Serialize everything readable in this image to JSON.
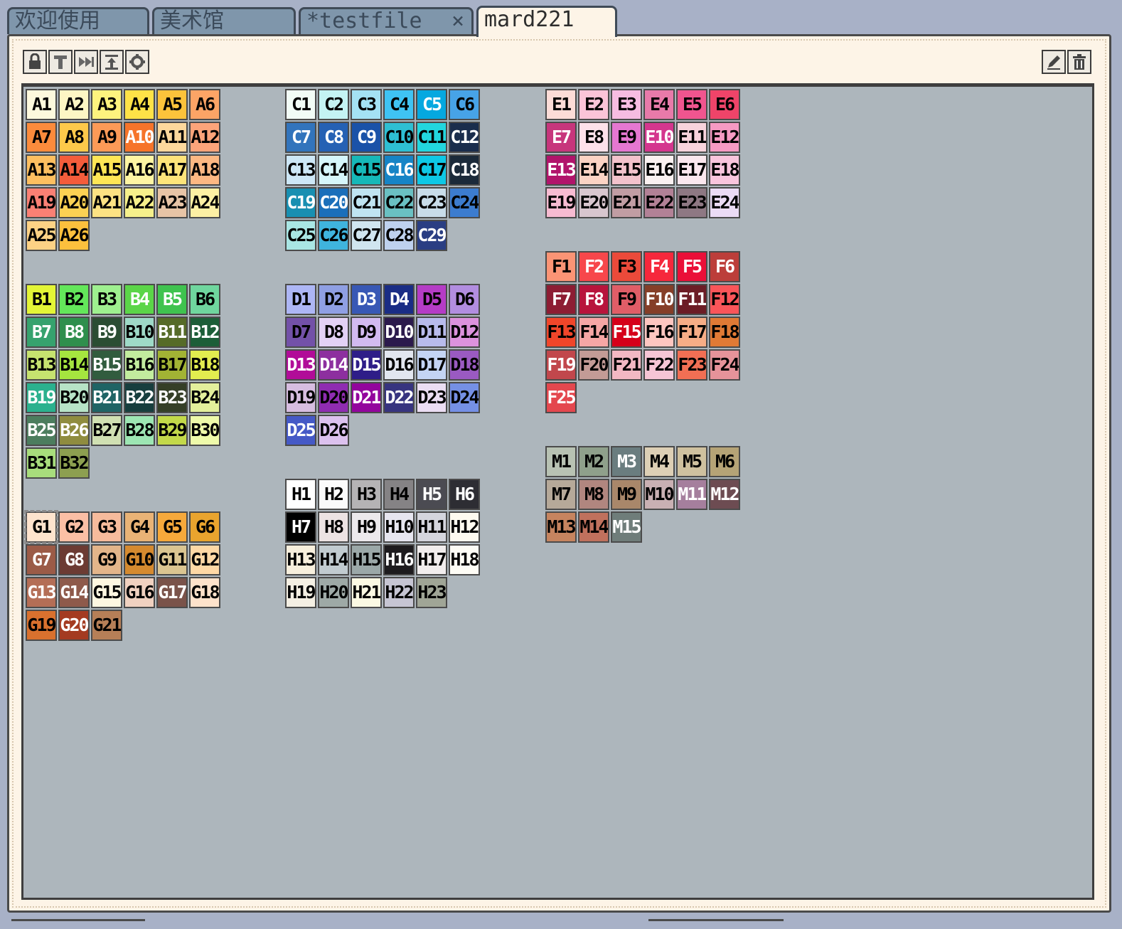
{
  "tabs": [
    {
      "label": "欢迎使用"
    },
    {
      "label": "美术馆"
    },
    {
      "label": "*testfile",
      "close": "×"
    },
    {
      "label": "mard221"
    }
  ],
  "toolbar": {
    "left_icons": [
      "lock-icon",
      "text-icon",
      "skip-icon",
      "align-icon",
      "settings-icon"
    ],
    "right_icons": [
      "edit-icon",
      "trash-icon"
    ]
  },
  "colors": {
    "A": [
      [
        "A1",
        "#fdf9dd",
        "#000"
      ],
      [
        "A2",
        "#fdf6c4",
        "#000"
      ],
      [
        "A3",
        "#fdf37e",
        "#000"
      ],
      [
        "A4",
        "#fee247",
        "#000"
      ],
      [
        "A5",
        "#fcc33b",
        "#000"
      ],
      [
        "A6",
        "#fca466",
        "#000"
      ],
      [
        "A7",
        "#fb8b3c",
        "#000"
      ],
      [
        "A8",
        "#fdc94a",
        "#000"
      ],
      [
        "A9",
        "#fc9a57",
        "#000"
      ],
      [
        "A10",
        "#f6742a",
        "#fff"
      ],
      [
        "A11",
        "#fdd89c",
        "#000"
      ],
      [
        "A12",
        "#fca47a",
        "#000"
      ],
      [
        "A13",
        "#fdbf60",
        "#000"
      ],
      [
        "A14",
        "#f45c3b",
        "#000"
      ],
      [
        "A15",
        "#fee655",
        "#000"
      ],
      [
        "A16",
        "#fef5a3",
        "#000"
      ],
      [
        "A17",
        "#fde47a",
        "#000"
      ],
      [
        "A18",
        "#fcb883",
        "#000"
      ],
      [
        "A19",
        "#fa8074",
        "#000"
      ],
      [
        "A20",
        "#fbd153",
        "#000"
      ],
      [
        "A21",
        "#fde283",
        "#000"
      ],
      [
        "A22",
        "#f6f08b",
        "#000"
      ],
      [
        "A23",
        "#e7c4a6",
        "#000"
      ],
      [
        "A24",
        "#fdf0a4",
        "#000"
      ],
      [
        "A25",
        "#fdd285",
        "#000"
      ],
      [
        "A26",
        "#fcc03d",
        "#000"
      ]
    ],
    "B": [
      [
        "B1",
        "#e3f536",
        "#000"
      ],
      [
        "B2",
        "#63e75a",
        "#000"
      ],
      [
        "B3",
        "#9ef08f",
        "#000"
      ],
      [
        "B4",
        "#5bd548",
        "#fff"
      ],
      [
        "B5",
        "#3fc34f",
        "#fff"
      ],
      [
        "B6",
        "#6fd69e",
        "#000"
      ],
      [
        "B7",
        "#36a26e",
        "#fff"
      ],
      [
        "B8",
        "#2f8f4d",
        "#fff"
      ],
      [
        "B9",
        "#2b4d33",
        "#fff"
      ],
      [
        "B10",
        "#9ed9c7",
        "#000"
      ],
      [
        "B11",
        "#566b28",
        "#fff"
      ],
      [
        "B12",
        "#1c5e38",
        "#fff"
      ],
      [
        "B13",
        "#c6e36f",
        "#000"
      ],
      [
        "B14",
        "#a5e53f",
        "#000"
      ],
      [
        "B15",
        "#315c3e",
        "#fff"
      ],
      [
        "B16",
        "#c2ec9e",
        "#000"
      ],
      [
        "B17",
        "#a2b334",
        "#000"
      ],
      [
        "B18",
        "#e2ec4f",
        "#000"
      ],
      [
        "B19",
        "#2bb18e",
        "#fff"
      ],
      [
        "B20",
        "#b7e3c6",
        "#000"
      ],
      [
        "B21",
        "#1f6465",
        "#fff"
      ],
      [
        "B22",
        "#173e3e",
        "#fff"
      ],
      [
        "B23",
        "#353f27",
        "#fff"
      ],
      [
        "B24",
        "#e3ef9b",
        "#000"
      ],
      [
        "B25",
        "#4c7d5e",
        "#fff"
      ],
      [
        "B26",
        "#8f8c3f",
        "#fff"
      ],
      [
        "B27",
        "#d0e0b2",
        "#000"
      ],
      [
        "B28",
        "#9de6b3",
        "#000"
      ],
      [
        "B29",
        "#c3d94a",
        "#000"
      ],
      [
        "B30",
        "#eefaaa",
        "#000"
      ],
      [
        "B31",
        "#a8dd7c",
        "#000"
      ],
      [
        "B32",
        "#8d9f50",
        "#000"
      ]
    ],
    "C": [
      [
        "C1",
        "#f2fcf6",
        "#000"
      ],
      [
        "C2",
        "#c4f3f3",
        "#000"
      ],
      [
        "C3",
        "#a4e2f4",
        "#000"
      ],
      [
        "C4",
        "#3fc3f3",
        "#000"
      ],
      [
        "C5",
        "#05a8e0",
        "#fff"
      ],
      [
        "C6",
        "#47a3e7",
        "#000"
      ],
      [
        "C7",
        "#3274bc",
        "#fff"
      ],
      [
        "C8",
        "#2561b4",
        "#fff"
      ],
      [
        "C9",
        "#1a52a8",
        "#fff"
      ],
      [
        "C10",
        "#2ebfd3",
        "#000"
      ],
      [
        "C11",
        "#22d6de",
        "#000"
      ],
      [
        "C12",
        "#1a2d4c",
        "#fff"
      ],
      [
        "C13",
        "#cde7f6",
        "#000"
      ],
      [
        "C14",
        "#d6f6fb",
        "#000"
      ],
      [
        "C15",
        "#16b8b8",
        "#000"
      ],
      [
        "C16",
        "#1684c6",
        "#fff"
      ],
      [
        "C17",
        "#0ec8e6",
        "#000"
      ],
      [
        "C18",
        "#1b2a3a",
        "#fff"
      ],
      [
        "C19",
        "#188fb1",
        "#fff"
      ],
      [
        "C20",
        "#1b6fba",
        "#fff"
      ],
      [
        "C21",
        "#bfe4f1",
        "#000"
      ],
      [
        "C22",
        "#6ac0c2",
        "#000"
      ],
      [
        "C23",
        "#c8dce9",
        "#000"
      ],
      [
        "C24",
        "#3c7ccf",
        "#000"
      ],
      [
        "C25",
        "#a9e6e4",
        "#000"
      ],
      [
        "C26",
        "#3fb4de",
        "#000"
      ],
      [
        "C27",
        "#d0e5ef",
        "#000"
      ],
      [
        "C28",
        "#bed1ee",
        "#000"
      ],
      [
        "C29",
        "#2a3e83",
        "#fff"
      ]
    ],
    "D": [
      [
        "D1",
        "#adb6f5",
        "#000"
      ],
      [
        "D2",
        "#8f9fe3",
        "#000"
      ],
      [
        "D3",
        "#3858b5",
        "#fff"
      ],
      [
        "D4",
        "#1a2d85",
        "#fff"
      ],
      [
        "D5",
        "#b53cc6",
        "#000"
      ],
      [
        "D6",
        "#b28de0",
        "#000"
      ],
      [
        "D7",
        "#7351a8",
        "#000"
      ],
      [
        "D8",
        "#e3d1f5",
        "#000"
      ],
      [
        "D9",
        "#d2baf0",
        "#000"
      ],
      [
        "D10",
        "#2b1a4c",
        "#fff"
      ],
      [
        "D11",
        "#b8bbec",
        "#000"
      ],
      [
        "D12",
        "#dc92dd",
        "#000"
      ],
      [
        "D13",
        "#b10c98",
        "#fff"
      ],
      [
        "D14",
        "#8d2f9f",
        "#fff"
      ],
      [
        "D15",
        "#2e1d88",
        "#fff"
      ],
      [
        "D16",
        "#e2e6ef",
        "#000"
      ],
      [
        "D17",
        "#c4d4f4",
        "#000"
      ],
      [
        "D18",
        "#9a5ac1",
        "#000"
      ],
      [
        "D19",
        "#d7bde0",
        "#000"
      ],
      [
        "D20",
        "#8f2cb1",
        "#000"
      ],
      [
        "D21",
        "#93059d",
        "#fff"
      ],
      [
        "D22",
        "#37347f",
        "#fff"
      ],
      [
        "D23",
        "#ebddf3",
        "#000"
      ],
      [
        "D24",
        "#7590e5",
        "#000"
      ],
      [
        "D25",
        "#4559c6",
        "#fff"
      ],
      [
        "D26",
        "#dcc1ee",
        "#000"
      ]
    ],
    "E": [
      [
        "E1",
        "#fcdcd7",
        "#000"
      ],
      [
        "E2",
        "#fbc4d8",
        "#000"
      ],
      [
        "E3",
        "#f6bce1",
        "#000"
      ],
      [
        "E4",
        "#e87aa9",
        "#000"
      ],
      [
        "E5",
        "#f0558f",
        "#000"
      ],
      [
        "E6",
        "#ef4469",
        "#000"
      ],
      [
        "E7",
        "#c7367c",
        "#fff"
      ],
      [
        "E8",
        "#fde1ea",
        "#000"
      ],
      [
        "E9",
        "#e577d1",
        "#000"
      ],
      [
        "E10",
        "#d4368e",
        "#fff"
      ],
      [
        "E11",
        "#f8d3dc",
        "#000"
      ],
      [
        "E12",
        "#f69ac3",
        "#000"
      ],
      [
        "E13",
        "#b1146b",
        "#fff"
      ],
      [
        "E14",
        "#fbd3c4",
        "#000"
      ],
      [
        "E15",
        "#f3c2cc",
        "#000"
      ],
      [
        "E16",
        "#faf1f1",
        "#000"
      ],
      [
        "E17",
        "#fbe7ee",
        "#000"
      ],
      [
        "E18",
        "#f9c5dd",
        "#000"
      ],
      [
        "E19",
        "#f7bbd1",
        "#000"
      ],
      [
        "E20",
        "#d8c6ce",
        "#000"
      ],
      [
        "E21",
        "#c19da3",
        "#000"
      ],
      [
        "E22",
        "#b28196",
        "#000"
      ],
      [
        "E23",
        "#8e7883",
        "#000"
      ],
      [
        "E24",
        "#ebdbf5",
        "#000"
      ]
    ],
    "F": [
      [
        "F1",
        "#fb9475",
        "#000"
      ],
      [
        "F2",
        "#f7474b",
        "#fff"
      ],
      [
        "F3",
        "#eb4a3a",
        "#000"
      ],
      [
        "F4",
        "#f6283c",
        "#fff"
      ],
      [
        "F5",
        "#ea0f38",
        "#fff"
      ],
      [
        "F6",
        "#bc3e3a",
        "#fff"
      ],
      [
        "F7",
        "#8d1d33",
        "#fff"
      ],
      [
        "F8",
        "#b8143c",
        "#fff"
      ],
      [
        "F9",
        "#e05d67",
        "#000"
      ],
      [
        "F10",
        "#853e28",
        "#fff"
      ],
      [
        "F11",
        "#6c1d26",
        "#fff"
      ],
      [
        "F12",
        "#fa5559",
        "#000"
      ],
      [
        "F13",
        "#f1462a",
        "#000"
      ],
      [
        "F14",
        "#f6a6a5",
        "#000"
      ],
      [
        "F15",
        "#d5001a",
        "#fff"
      ],
      [
        "F16",
        "#fdc6c0",
        "#000"
      ],
      [
        "F17",
        "#f6ad86",
        "#000"
      ],
      [
        "F18",
        "#e07a35",
        "#000"
      ],
      [
        "F19",
        "#c1474c",
        "#fff"
      ],
      [
        "F20",
        "#c39b96",
        "#000"
      ],
      [
        "F21",
        "#f2b8c3",
        "#000"
      ],
      [
        "F22",
        "#f6c5d5",
        "#000"
      ],
      [
        "F23",
        "#f26f54",
        "#000"
      ],
      [
        "F24",
        "#e6939a",
        "#000"
      ],
      [
        "F25",
        "#e4474e",
        "#fff"
      ]
    ],
    "G": [
      [
        "G1",
        "#fde3cd",
        "#000"
      ],
      [
        "G2",
        "#fbbfa5",
        "#000"
      ],
      [
        "G3",
        "#f6bb9c",
        "#000"
      ],
      [
        "G4",
        "#e9b376",
        "#000"
      ],
      [
        "G5",
        "#f6a93b",
        "#000"
      ],
      [
        "G6",
        "#e9a42e",
        "#000"
      ],
      [
        "G7",
        "#9b5b47",
        "#fff"
      ],
      [
        "G8",
        "#6c3b33",
        "#fff"
      ],
      [
        "G9",
        "#e3b58a",
        "#000"
      ],
      [
        "G10",
        "#d58a2f",
        "#000"
      ],
      [
        "G11",
        "#dbc591",
        "#000"
      ],
      [
        "G12",
        "#fed8a5",
        "#000"
      ],
      [
        "G13",
        "#b46e56",
        "#fff"
      ],
      [
        "G14",
        "#8e5a4b",
        "#fff"
      ],
      [
        "G15",
        "#fef7e1",
        "#000"
      ],
      [
        "G16",
        "#f0d1c0",
        "#000"
      ],
      [
        "G17",
        "#7a534a",
        "#fff"
      ],
      [
        "G18",
        "#fde2cb",
        "#000"
      ],
      [
        "G19",
        "#d9712e",
        "#000"
      ],
      [
        "G20",
        "#a43b21",
        "#fff"
      ],
      [
        "G21",
        "#b67f57",
        "#000"
      ]
    ],
    "H": [
      [
        "H1",
        "#ffffff",
        "#000"
      ],
      [
        "H2",
        "#fbfbfb",
        "#000"
      ],
      [
        "H3",
        "#b5b3b5",
        "#000"
      ],
      [
        "H4",
        "#858385",
        "#000"
      ],
      [
        "H5",
        "#4b4b52",
        "#fff"
      ],
      [
        "H6",
        "#2d2d33",
        "#fff"
      ],
      [
        "H7",
        "#000000",
        "#fff"
      ],
      [
        "H8",
        "#ece3e3",
        "#000"
      ],
      [
        "H9",
        "#ece9ec",
        "#000"
      ],
      [
        "H10",
        "#e6e6f0",
        "#000"
      ],
      [
        "H11",
        "#d4d5dd",
        "#000"
      ],
      [
        "H12",
        "#fdfaf0",
        "#000"
      ],
      [
        "H13",
        "#f7efdd",
        "#000"
      ],
      [
        "H14",
        "#c1cbd0",
        "#000"
      ],
      [
        "H15",
        "#9ba8a8",
        "#000"
      ],
      [
        "H16",
        "#1d1b1e",
        "#fff"
      ],
      [
        "H17",
        "#f1eded",
        "#000"
      ],
      [
        "H18",
        "#fdfcf5",
        "#000"
      ],
      [
        "H19",
        "#f4efe3",
        "#000"
      ],
      [
        "H20",
        "#9ea9a6",
        "#000"
      ],
      [
        "H21",
        "#fbf9e3",
        "#000"
      ],
      [
        "H22",
        "#c6c5d3",
        "#000"
      ],
      [
        "H23",
        "#a0a596",
        "#000"
      ]
    ],
    "M": [
      [
        "M1",
        "#b8c2b3",
        "#000"
      ],
      [
        "M2",
        "#8fa08b",
        "#000"
      ],
      [
        "M3",
        "#6a7d7f",
        "#fff"
      ],
      [
        "M4",
        "#ddcfb5",
        "#000"
      ],
      [
        "M5",
        "#cfc19f",
        "#000"
      ],
      [
        "M6",
        "#b5a376",
        "#000"
      ],
      [
        "M7",
        "#b6a999",
        "#000"
      ],
      [
        "M8",
        "#b1867f",
        "#000"
      ],
      [
        "M9",
        "#a9876a",
        "#000"
      ],
      [
        "M10",
        "#c9b0b3",
        "#000"
      ],
      [
        "M11",
        "#a57f9d",
        "#fff"
      ],
      [
        "M12",
        "#6d4c52",
        "#fff"
      ],
      [
        "M13",
        "#c6845f",
        "#000"
      ],
      [
        "M14",
        "#c0715d",
        "#000"
      ],
      [
        "M15",
        "#6f7d7a",
        "#fff"
      ]
    ]
  }
}
